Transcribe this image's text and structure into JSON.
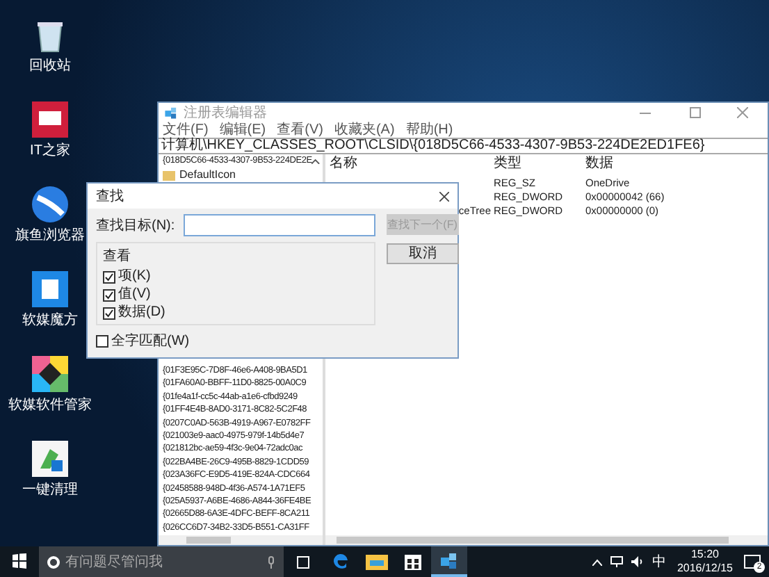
{
  "desktop_icons": [
    {
      "kind": "recycle",
      "label": "回收站"
    },
    {
      "kind": "it",
      "label": "IT之家"
    },
    {
      "kind": "browser",
      "label": "旗鱼浏览器"
    },
    {
      "kind": "cube",
      "label": "软媒魔方"
    },
    {
      "kind": "manager",
      "label": "软媒软件管家"
    },
    {
      "kind": "clean",
      "label": "一键清理"
    }
  ],
  "regedit": {
    "title": "注册表编辑器",
    "menu": [
      "文件(F)",
      "编辑(E)",
      "查看(V)",
      "收藏夹(A)",
      "帮助(H)"
    ],
    "address": "计算机\\HKEY_CLASSES_ROOT\\CLSID\\{018D5C66-4533-4307-9B53-224DE2ED1FE6}",
    "tree_top": [
      {
        "label": "{018D5C66-4533-4307-9B53-224DE2E",
        "kind": "key"
      },
      {
        "label": "DefaultIcon",
        "kind": "folder"
      }
    ],
    "tree_keys": [
      "{01F3E95C-7D8F-46e6-A408-9BA5D1",
      "{01FA60A0-BBFF-11D0-8825-00A0C9",
      "{01fe4a1f-cc5c-44ab-a1e6-cfbd9249",
      "{01FF4E4B-8AD0-3171-8C82-5C2F48",
      "{0207C0AD-563B-4919-A967-E0782FF",
      "{021003e9-aac0-4975-979f-14b5d4e7",
      "{021812bc-ae59-4f3c-9e04-72adc0ac",
      "{022BA4BE-26C9-495B-8829-1CDD59",
      "{023A36FC-E9D5-419E-824A-CDC664",
      "{02458588-948D-4f36-A574-1A71EF5",
      "{025A5937-A6BE-4686-A844-36FE4BE",
      "{02665D88-6A3E-4DFC-BEFF-8CA211",
      "{026CC6D7-34B2-33D5-B551-CA31FF"
    ],
    "columns": [
      "名称",
      "类型",
      "数据"
    ],
    "rows": [
      {
        "type": "REG_SZ",
        "data": "OneDrive"
      },
      {
        "type": "REG_DWORD",
        "data": "0x00000042 (66)"
      },
      {
        "name": "ceTree",
        "type": "REG_DWORD",
        "data": "0x00000000 (0)"
      }
    ]
  },
  "find_dialog": {
    "title": "查找",
    "target_label": "查找目标(N):",
    "find_next": {
      "label": "查找下一个(F)",
      "disabled": true
    },
    "cancel": "取消",
    "group_title": "查看",
    "options": [
      {
        "label": "项(K)",
        "checked": true
      },
      {
        "label": "值(V)",
        "checked": true
      },
      {
        "label": "数据(D)",
        "checked": true
      }
    ],
    "whole_word": {
      "label": "全字匹配(W)",
      "checked": false
    }
  },
  "taskbar": {
    "search_placeholder": "有问题尽管问我",
    "apps": [
      {
        "kind": "edge",
        "selected": false
      },
      {
        "kind": "explorer",
        "selected": false
      },
      {
        "kind": "store",
        "selected": false
      },
      {
        "kind": "regedit",
        "selected": true
      }
    ],
    "ime": "中",
    "time": "15:20",
    "date": "2016/12/15",
    "notifications": "2"
  }
}
